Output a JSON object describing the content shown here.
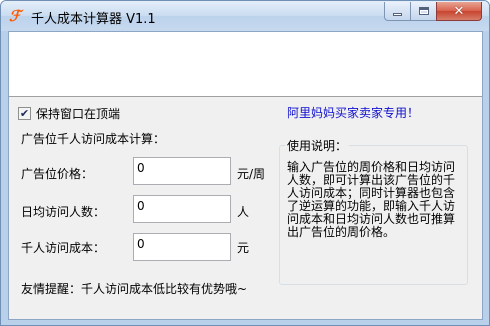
{
  "window": {
    "title": "千人成本计算器 V1.1",
    "icon": "app-logo-icon",
    "icon_glyph": "ℱ",
    "controls": {
      "minimize": "minimize-icon",
      "maximize": "maximize-icon",
      "close": "close-icon",
      "close_glyph": "✕"
    }
  },
  "options": {
    "keep_on_top_label": "保持窗口在顶端",
    "keep_on_top_checked": true,
    "check_glyph": "✔"
  },
  "promo_text": "阿里妈妈买家卖家专用！",
  "calculator": {
    "group_title": "广告位千人访问成本计算：",
    "rows": [
      {
        "label": "广告位价格：",
        "value": "0",
        "unit": "元/周"
      },
      {
        "label": "日均访问人数：",
        "value": "0",
        "unit": "人"
      },
      {
        "label": "千人访问成本：",
        "value": "0",
        "unit": "元"
      }
    ]
  },
  "help": {
    "title": "使用说明：",
    "text": "输入广告位的周价格和日均访问人数，即可计算出该广告位的千人访问成本；同时计算器也包含了逆运算的功能，即输入千人访问成本和日均访问人数也可推算出广告位的周价格。"
  },
  "tip": "友情提醒：千人访问成本低比较有优势哦~",
  "colors": {
    "promo": "#1010d0",
    "close_button": "#c7442e",
    "accent_icon": "#ff5a00"
  }
}
